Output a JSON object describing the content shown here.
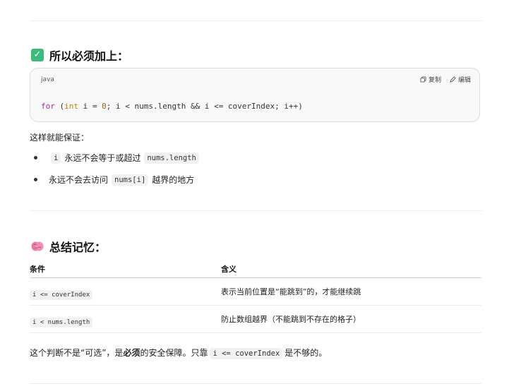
{
  "section1": {
    "heading": "所以必须加上：",
    "icon": "check-mark-button-icon",
    "code": {
      "lang": "java",
      "copy_label": "复制",
      "edit_label": "编辑",
      "tokens": {
        "for": "for",
        "open": " (",
        "int": "int",
        "decl": " i = ",
        "zero": "0",
        "rest": "; i < nums.length && i <= coverIndex; i++)"
      }
    },
    "intro": "这样就能保证：",
    "bullets": [
      {
        "code": "i",
        "text": "永远不会等于或超过",
        "code2": "nums.length"
      },
      {
        "text": "永远不会去访问",
        "code": "nums[i]",
        "text2": "越界的地方"
      }
    ]
  },
  "section2": {
    "heading": "总结记忆：",
    "icon": "brain-icon",
    "table": {
      "headers": [
        "条件",
        "含义"
      ],
      "rows": [
        {
          "cond": "i <= coverIndex",
          "meaning": "表示当前位置是“能跳到”的，才能继续跳"
        },
        {
          "cond": "i < nums.length",
          "meaning": "防止数组越界（不能跳到不存在的格子）"
        }
      ]
    }
  },
  "final": {
    "t1": "这个判断不是“可选”，是",
    "bold": "必须",
    "t2": "的安全保障。只靠",
    "code": "i <= coverIndex",
    "t3": "是不够的。"
  },
  "colors": {
    "keyword": "#a626a4",
    "type": "#c18401",
    "number": "#986801",
    "check_green": "#3dbb7c",
    "brain_pink": "#e77aa6"
  }
}
